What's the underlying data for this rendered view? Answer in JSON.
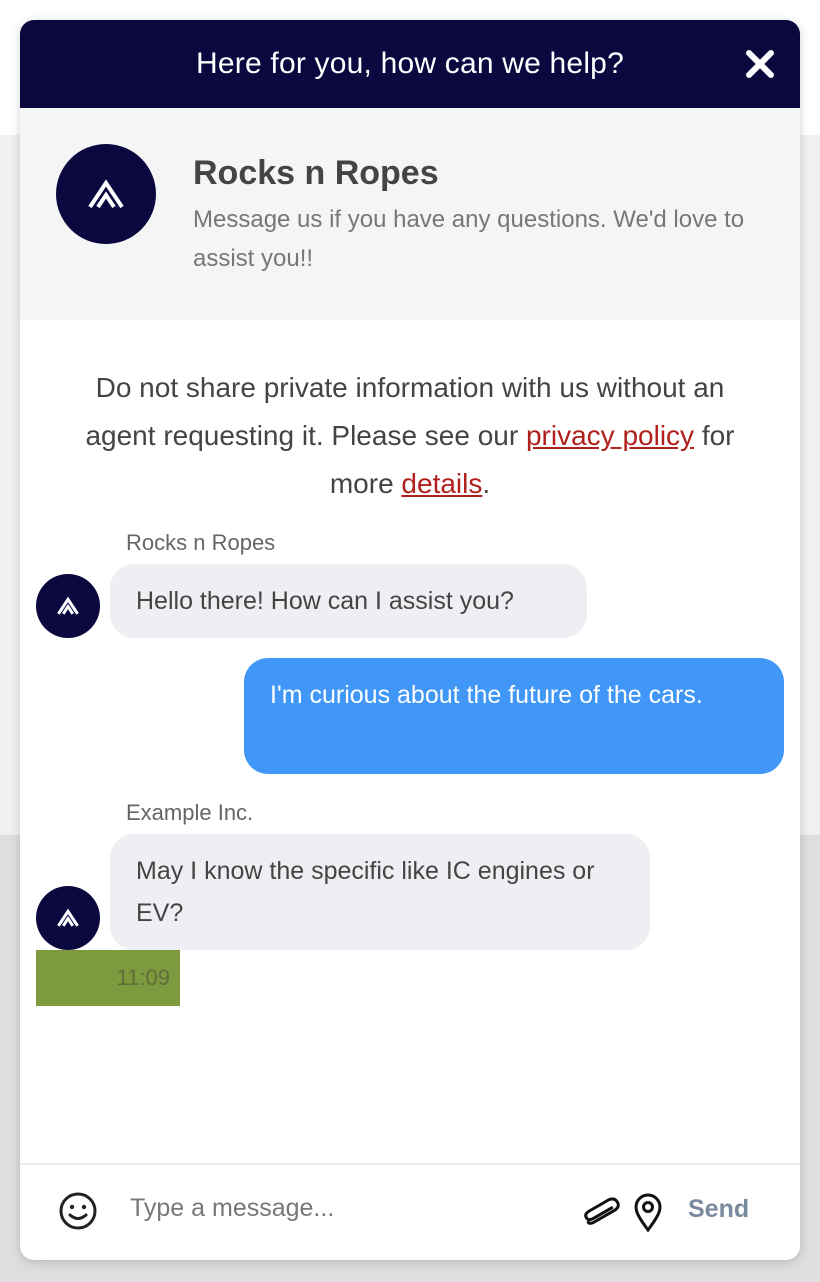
{
  "header": {
    "title": "Here for you, how can we help?"
  },
  "brand": {
    "name": "Rocks n Ropes",
    "description": "Message us if you have any questions. We'd love to assist you!!"
  },
  "notice": {
    "text_before": "Do not share private information with us without an agent requesting it. Please see our ",
    "privacy_link": "privacy policy",
    "text_middle": " for more ",
    "details_link": "details",
    "text_after": "."
  },
  "messages": [
    {
      "sender": "Rocks n Ropes",
      "text": "Hello there! How can I assist you?",
      "direction": "incoming"
    },
    {
      "sender": "",
      "text": "I'm curious about the future of the cars.",
      "direction": "outgoing"
    },
    {
      "sender": "Example Inc.",
      "text": "May I know the specific like IC engines or EV?",
      "direction": "incoming",
      "time": "11:09"
    }
  ],
  "composer": {
    "placeholder": "Type a message...",
    "send_label": "Send"
  },
  "colors": {
    "header_bg": "#0b0840",
    "outgoing_bubble": "#4097f7",
    "incoming_bubble": "#efeff3",
    "link": "#b0201c",
    "timestamp_bg": "#7d9a3e"
  },
  "icons": [
    "close-icon",
    "brand-logo-icon",
    "emoji-icon",
    "paperclip-icon",
    "location-pin-icon"
  ]
}
